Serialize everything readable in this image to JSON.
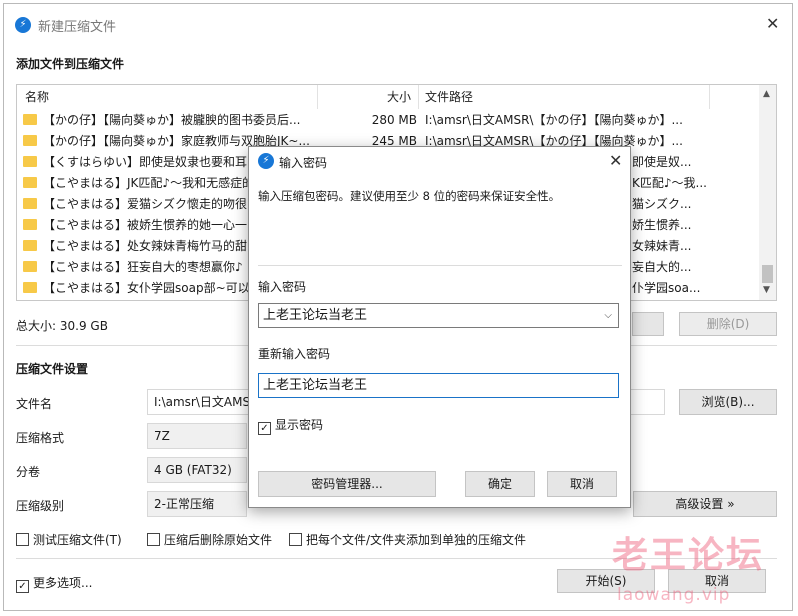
{
  "window": {
    "title": "新建压缩文件"
  },
  "add_section": {
    "heading": "添加文件到压缩文件"
  },
  "file_list": {
    "columns": {
      "name": "名称",
      "size": "大小",
      "path": "文件路径"
    },
    "rows": [
      {
        "name": "【かの仔】【陽向葵ゅか】被朧腴的图书委员后...",
        "size": "280 MB",
        "path": "I:\\amsr\\日文AMSR\\【かの仔】【陽向葵ゅか】..."
      },
      {
        "name": "【かの仔】【陽向葵ゅか】家庭教师与双胞胎JK~...",
        "size": "245 MB",
        "path": "I:\\amsr\\日文AMSR\\【かの仔】【陽向葵ゅか】..."
      },
      {
        "name": "【くすはらゆい】即使是奴隶也要和耳",
        "size": "",
        "path": "即使是奴..."
      },
      {
        "name": "【こやまはる】JK匹配♪～我和无感症的",
        "size": "",
        "path": "K匹配♪～我..."
      },
      {
        "name": "【こやまはる】爱猫シズク懷走的吻很",
        "size": "",
        "path": "猫シズク..."
      },
      {
        "name": "【こやまはる】被娇生惯养的她一心一",
        "size": "",
        "path": "娇生惯养..."
      },
      {
        "name": "【こやまはる】处女辣妹青梅竹马的甜",
        "size": "",
        "path": "女辣妹青..."
      },
      {
        "name": "【こやまはる】狂妄自大的枣想赢你♪",
        "size": "",
        "path": "妄自大的..."
      },
      {
        "name": "【こやまはる】女仆学园soap部~可以",
        "size": "",
        "path": "仆学园soa..."
      }
    ]
  },
  "total_size": "总大小: 30.9 GB",
  "delete_button": "删除(D)",
  "settings": {
    "heading": "压缩文件设置",
    "filename_label": "文件名",
    "filename_value": "I:\\amsr\\日文AMS",
    "browse_button": "浏览(B)...",
    "format_label": "压缩格式",
    "format_value": "7Z",
    "split_label": "分卷",
    "split_value": "4 GB (FAT32)",
    "level_label": "压缩级别",
    "level_value": "2-正常压缩",
    "advanced_button": "高级设置 »"
  },
  "options": {
    "test": "测试压缩文件(T)",
    "delete_after": "压缩后删除原始文件",
    "separate": "把每个文件/文件夹添加到单独的压缩文件",
    "more": "更多选项..."
  },
  "buttons": {
    "start": "开始(S)",
    "cancel": "取消"
  },
  "dialog": {
    "title": "输入密码",
    "description": "输入压缩包密码。建议使用至少 8 位的密码来保证安全性。",
    "password_label": "输入密码",
    "password_value": "上老王论坛当老王",
    "reenter_label": "重新输入密码",
    "reenter_value": "上老王论坛当老王",
    "show_password": "显示密码",
    "manager_button": "密码管理器...",
    "ok_button": "确定",
    "cancel_button": "取消"
  },
  "watermark": {
    "text": "老王论坛",
    "url": "laowang.vip"
  }
}
